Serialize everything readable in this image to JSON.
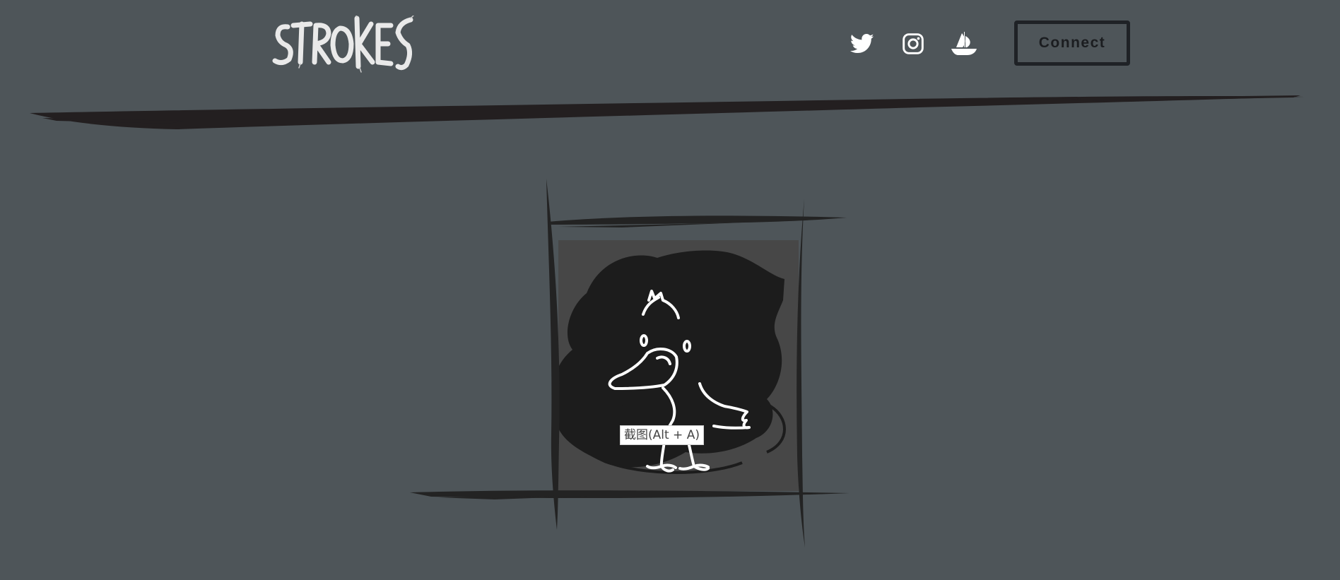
{
  "header": {
    "logo_text": "STROKES",
    "social_links": [
      {
        "name": "twitter",
        "icon": "twitter-icon"
      },
      {
        "name": "instagram",
        "icon": "instagram-icon"
      },
      {
        "name": "opensea",
        "icon": "opensea-icon"
      }
    ],
    "connect_label": "Connect"
  },
  "main": {
    "artwork_icon": "crow-illustration"
  },
  "tooltip": {
    "text": "截图(Alt + A)"
  },
  "colors": {
    "background": "#4e5559",
    "ink": "#1f1f22",
    "frame_fill": "#474747",
    "white": "#ffffff"
  }
}
